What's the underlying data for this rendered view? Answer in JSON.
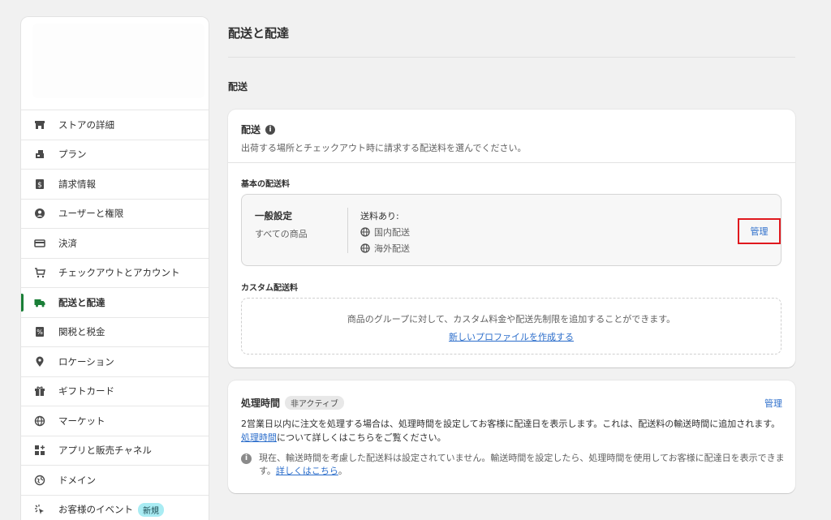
{
  "sidebar": {
    "items": [
      {
        "label": "ストアの詳細",
        "icon": "store-icon"
      },
      {
        "label": "プラン",
        "icon": "plan-icon"
      },
      {
        "label": "請求情報",
        "icon": "billing-icon"
      },
      {
        "label": "ユーザーと権限",
        "icon": "user-icon"
      },
      {
        "label": "決済",
        "icon": "payment-icon"
      },
      {
        "label": "チェックアウトとアカウント",
        "icon": "cart-icon"
      },
      {
        "label": "配送と配達",
        "icon": "truck-icon",
        "active": true
      },
      {
        "label": "関税と税金",
        "icon": "tax-icon"
      },
      {
        "label": "ロケーション",
        "icon": "location-icon"
      },
      {
        "label": "ギフトカード",
        "icon": "gift-icon"
      },
      {
        "label": "マーケット",
        "icon": "globe-icon"
      },
      {
        "label": "アプリと販売チャネル",
        "icon": "apps-icon"
      },
      {
        "label": "ドメイン",
        "icon": "domain-icon"
      },
      {
        "label": "お客様のイベント",
        "icon": "events-icon",
        "badge": "新規"
      }
    ]
  },
  "main": {
    "page_title": "配送と配達",
    "section_title": "配送",
    "shipping_card": {
      "title": "配送",
      "description": "出荷する場所とチェックアウト時に請求する配送料を選んでください。",
      "general_rates_label": "基本の配送料",
      "profile": {
        "name": "一般設定",
        "scope": "すべての商品",
        "rates_label": "送料あり:",
        "zones": [
          "国内配送",
          "海外配送"
        ],
        "manage_label": "管理"
      },
      "custom_rates_label": "カスタム配送料",
      "custom_description": "商品のグループに対して、カスタム料金や配送先制限を追加することができます。",
      "create_profile_link": "新しいプロファイルを作成する"
    },
    "processing_card": {
      "title": "処理時間",
      "status_badge": "非アクティブ",
      "manage_label": "管理",
      "body_before_link": "2営業日以内に注文を処理する場合は、処理時間を設定してお客様に配達日を表示します。これは、配送料の輸送時間に追加されます。",
      "body_link": "処理時間",
      "body_after_link": "について詳しくはこちらをご覧ください。",
      "note_text": "現在、輸送時間を考慮した配送料は設定されていません。輸送時間を設定したら、処理時間を使用してお客様に配達日を表示できます。",
      "note_link": "詳しくはこちら",
      "note_end": "。"
    }
  },
  "colors": {
    "accent_link": "#2c6ecb",
    "active_indicator": "#1a7f37",
    "highlight_border": "#e0191e",
    "new_badge": "#a9ecf3"
  }
}
